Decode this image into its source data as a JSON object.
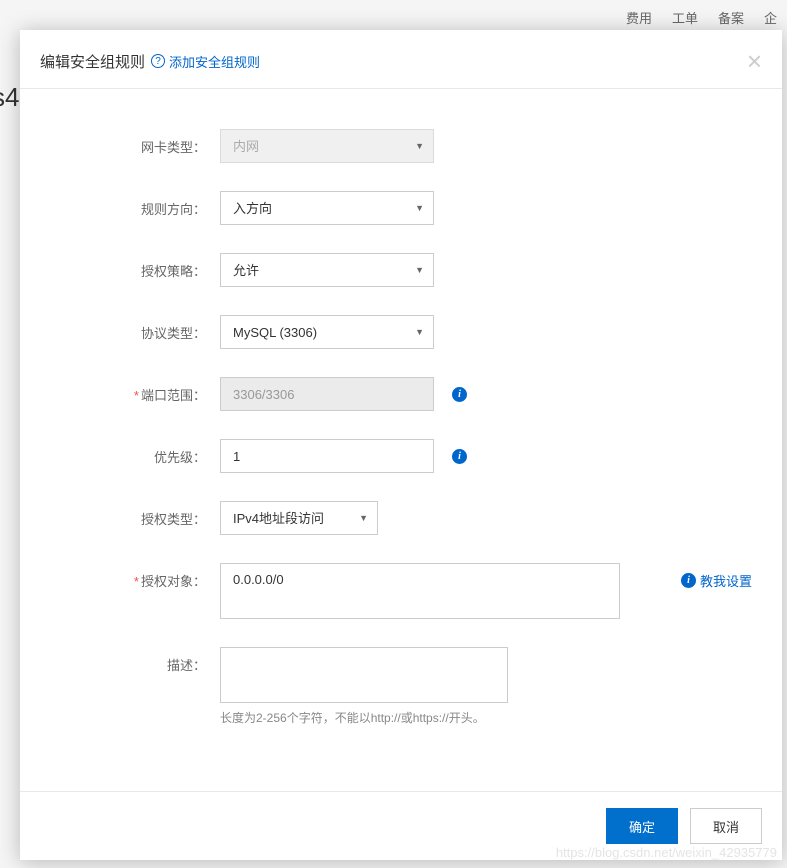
{
  "topNav": {
    "item1": "费用",
    "item2": "工单",
    "item3": "备案",
    "item4": "企"
  },
  "bgText": "s4",
  "modal": {
    "title": "编辑安全组规则",
    "subtitleLink": "添加安全组规则",
    "helpGlyph": "?"
  },
  "form": {
    "nicType": {
      "label": "网卡类型：",
      "value": "内网"
    },
    "direction": {
      "label": "规则方向：",
      "value": "入方向"
    },
    "authPolicy": {
      "label": "授权策略：",
      "value": "允许"
    },
    "protocol": {
      "label": "协议类型：",
      "value": "MySQL (3306)"
    },
    "portRange": {
      "label": "端口范围：",
      "value": "3306/3306"
    },
    "priority": {
      "label": "优先级：",
      "value": "1"
    },
    "authType": {
      "label": "授权类型：",
      "value": "IPv4地址段访问"
    },
    "authObject": {
      "label": "授权对象：",
      "value": "0.0.0.0/0",
      "helpLink": "教我设置"
    },
    "description": {
      "label": "描述：",
      "value": "",
      "hint": "长度为2-256个字符，不能以http://或https://开头。"
    }
  },
  "buttons": {
    "confirm": "确定",
    "cancel": "取消"
  },
  "infoGlyph": "i",
  "watermark": "https://blog.csdn.net/weixin_42935779"
}
